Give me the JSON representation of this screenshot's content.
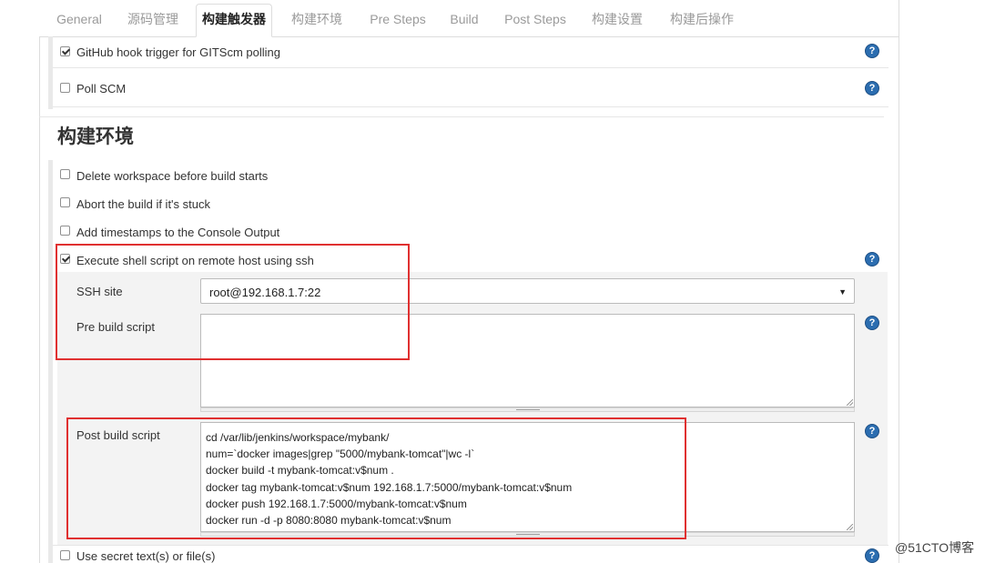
{
  "tabs": [
    {
      "label": "General"
    },
    {
      "label": "源码管理"
    },
    {
      "label": "构建触发器",
      "active": true
    },
    {
      "label": "构建环境"
    },
    {
      "label": "Pre Steps"
    },
    {
      "label": "Build"
    },
    {
      "label": "Post Steps"
    },
    {
      "label": "构建设置"
    },
    {
      "label": "构建后操作"
    }
  ],
  "triggers": {
    "github_hook": {
      "label": "GitHub hook trigger for GITScm polling",
      "checked": true
    },
    "poll_scm": {
      "label": "Poll SCM",
      "checked": false
    }
  },
  "build_env": {
    "title": "构建环境",
    "delete_workspace": {
      "label": "Delete workspace before build starts",
      "checked": false
    },
    "abort_stuck": {
      "label": "Abort the build if it's stuck",
      "checked": false
    },
    "timestamps": {
      "label": "Add timestamps to the Console Output",
      "checked": false
    },
    "ssh_script": {
      "label": "Execute shell script on remote host using ssh",
      "checked": true
    },
    "ssh_site_label": "SSH site",
    "ssh_site_value": "root@192.168.1.7:22",
    "pre_build_label": "Pre build script",
    "pre_build_value": "",
    "post_build_label": "Post build script",
    "post_build_lines": [
      "cd /var/lib/jenkins/workspace/mybank/",
      "num=`docker images|grep \"5000/mybank-tomcat\"|wc -l`",
      "docker build -t mybank-tomcat:v$num .",
      "docker tag mybank-tomcat:v$num 192.168.1.7:5000/mybank-tomcat:v$num",
      "docker push 192.168.1.7:5000/mybank-tomcat:v$num",
      "docker run -d -p 8080:8080 mybank-tomcat:v$num"
    ],
    "secret": {
      "label": "Use secret text(s) or file(s)",
      "checked": false
    }
  },
  "help_glyph": "?",
  "select_arrow": "▼",
  "watermark": "@51CTO博客",
  "colors": {
    "highlight": "#e03030",
    "help": "#2b6db0"
  }
}
